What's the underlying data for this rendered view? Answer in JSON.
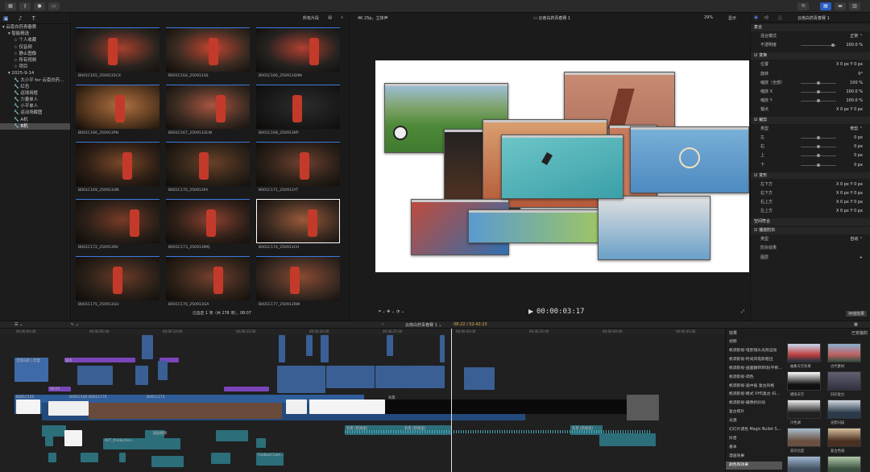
{
  "toolbar": {
    "fcp_icon": "film-icon"
  },
  "library": {
    "items": [
      {
        "label": "▾ 云南白药青春赛",
        "indent": 0,
        "sel": false
      },
      {
        "label": "▾ 智能精选",
        "indent": 1,
        "sel": false
      },
      {
        "label": "☆ 个人收藏",
        "indent": 2,
        "sel": false
      },
      {
        "label": "☆ 仅音频",
        "indent": 2,
        "sel": false
      },
      {
        "label": "☆ 静止图像",
        "indent": 2,
        "sel": false
      },
      {
        "label": "☆ 所有视频",
        "indent": 2,
        "sel": false
      },
      {
        "label": "☆ 项目",
        "indent": 2,
        "sel": false
      },
      {
        "label": "▾ 2025-9-14",
        "indent": 1,
        "sel": false
      },
      {
        "label": "🔧 大小平 for 云南白药…",
        "indent": 2,
        "sel": false
      },
      {
        "label": "🔧 红色",
        "indent": 2,
        "sel": false
      },
      {
        "label": "🔧 运球用框",
        "indent": 2,
        "sel": false
      },
      {
        "label": "🔧 力量单人",
        "indent": 2,
        "sel": false
      },
      {
        "label": "🔧 小平单人",
        "indent": 2,
        "sel": false
      },
      {
        "label": "🔧 运动场截图",
        "indent": 2,
        "sel": false
      },
      {
        "label": "🔧 A机",
        "indent": 2,
        "sel": false
      },
      {
        "label": "🔧 B机",
        "indent": 2,
        "sel": true
      }
    ]
  },
  "browser": {
    "filter": "所有片段",
    "status": "已选定 1 项（共 278 项），08:07",
    "clips": [
      "B001C165_2509135CX",
      "B001C164_2509133S",
      "B001C166_250913Q9N",
      "B001C166_250913PN",
      "B001C167_2509133CW",
      "B001C168_250913KP",
      "B001C169_250913UN",
      "B001C170_250913FA",
      "B001C171_250913YT",
      "B001C172_250913RV",
      "B001C173_250913MQ",
      "B001C174_250913CH",
      "B001C175_250913GU",
      "B001C176_250913GA",
      "B001C177_250913RW"
    ]
  },
  "viewer": {
    "format": "4K 25p，立体声",
    "project": "云南白药青春赛 1",
    "zoom": "29%",
    "display": "显示",
    "timecode": "00:00:03:17"
  },
  "inspector": {
    "title": "云南白药青春赛 1",
    "rows": [
      {
        "label": "复合",
        "val": "",
        "head": true
      },
      {
        "label": "混合模式",
        "val": "正常 ⌃"
      },
      {
        "label": "不透明度",
        "val": "100.0 %"
      },
      {
        "label": "☑ 变换",
        "val": "",
        "head": true
      },
      {
        "label": "位置",
        "val": "X  0 px   Y  0 px"
      },
      {
        "label": "旋转",
        "val": "0°"
      },
      {
        "label": "缩放（全部）",
        "val": "100 %"
      },
      {
        "label": "缩放 X",
        "val": "100.0 %"
      },
      {
        "label": "缩放 Y",
        "val": "100.0 %"
      },
      {
        "label": "锚点",
        "val": "X 0 px  Y 0 px"
      },
      {
        "label": "☑ 裁剪",
        "val": "",
        "head": true
      },
      {
        "label": "类型",
        "val": "修剪 ⌃"
      },
      {
        "label": "左",
        "val": "0 px"
      },
      {
        "label": "右",
        "val": "0 px"
      },
      {
        "label": "上",
        "val": "0 px"
      },
      {
        "label": "下",
        "val": "0 px"
      },
      {
        "label": "☑ 变形",
        "val": "",
        "head": true
      },
      {
        "label": "左下方",
        "val": "X 0 px  Y 0 px"
      },
      {
        "label": "右下方",
        "val": "X 0 px  Y 0 px"
      },
      {
        "label": "右上方",
        "val": "X 0 px  Y 0 px"
      },
      {
        "label": "左上方",
        "val": "X 0 px  Y 0 px"
      },
      {
        "label": "空间符合",
        "val": "",
        "head": true
      },
      {
        "label": "☑ 播放防抖",
        "val": "",
        "head": true
      },
      {
        "label": "类型",
        "val": "自动 ⌃"
      },
      {
        "label": "防抖效果",
        "val": ""
      },
      {
        "label": "图层",
        "val": "+"
      }
    ],
    "save_label": "存储效果"
  },
  "timeline": {
    "project": "云南白药青春赛 1 ⌄",
    "duration": "08:22 / 02:42:23",
    "ticks": [
      "00:00:00:00",
      "00:00:05:00",
      "00:00:10:00",
      "00:00:15:00",
      "00:00:20:00",
      "00:00:25:00",
      "00:00:30:00",
      "00:00:35:00",
      "00:00:40:00",
      "00:00:45:00",
      "00:00:50:00"
    ],
    "clip_labels": [
      "云南白药 | 年度",
      "城市",
      "00:05",
      "B001C165",
      "B001C166",
      "B001C170",
      "B001C173",
      "背景",
      "AVT_Production…",
      "插画视频",
      "Football Cam…",
      "背景 (新闻类)",
      "背景 (新闻类)",
      "背景 (新闻类)"
    ]
  },
  "effects": {
    "header": "效果",
    "installed": "已安装的",
    "categories": [
      "视频",
      "帆调影视-电影镜头光效运动",
      "帆调影视-时尚风电影框出",
      "帆调影视-画面翻转转场(平移…",
      "帆调影视-调色",
      "帆调影视-画中画 复古风格",
      "帆调影视-模式 VHS复古 扫…",
      "帆调影视-摄像机抖动",
      "复古照片",
      "光源",
      "幻灯片调色 Magic Bullet S…",
      "抖音",
      "基本",
      "漫画效果",
      "颜色和效果"
    ],
    "selected": 14,
    "thumbs": [
      "抽象天空效果",
      "古代素材",
      "模拟天空",
      "旧旧复古",
      "冷色调",
      "光影扫描",
      "高对比度",
      "复古色调",
      "远景天空",
      "山水调色"
    ]
  }
}
